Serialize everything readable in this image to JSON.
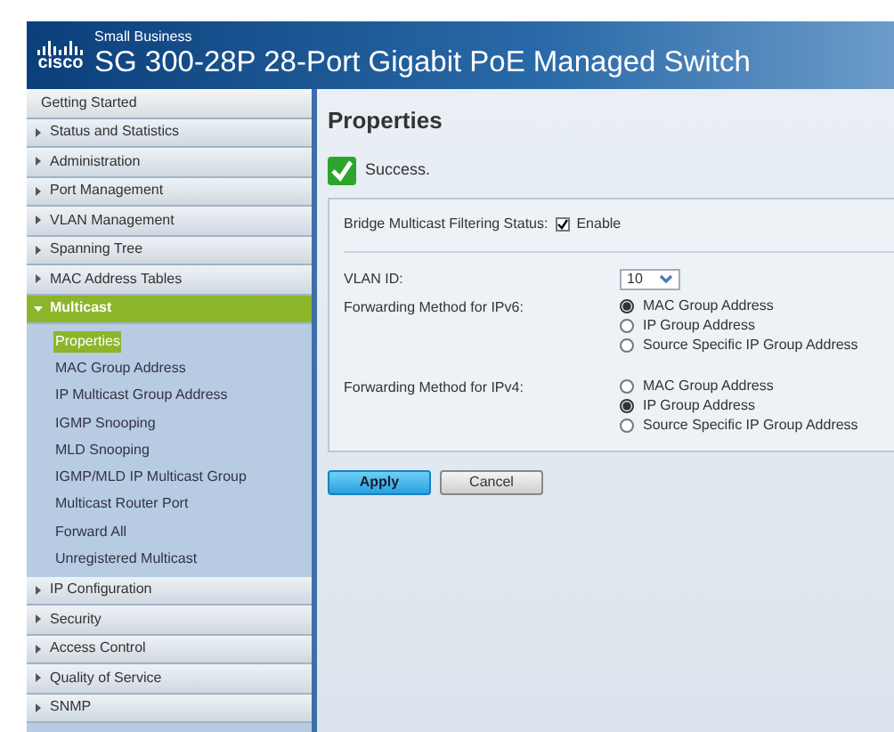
{
  "header": {
    "logo": "cisco",
    "subtitle": "Small Business",
    "title": "SG 300-28P 28-Port Gigabit PoE Managed Switch"
  },
  "sidebar": {
    "items": [
      {
        "label": "Getting Started",
        "kind": "plain"
      },
      {
        "label": "Status and Statistics",
        "kind": "section",
        "expanded": false
      },
      {
        "label": "Administration",
        "kind": "section",
        "expanded": false
      },
      {
        "label": "Port Management",
        "kind": "section",
        "expanded": false
      },
      {
        "label": "VLAN Management",
        "kind": "section",
        "expanded": false
      },
      {
        "label": "Spanning Tree",
        "kind": "section",
        "expanded": false
      },
      {
        "label": "MAC Address Tables",
        "kind": "section",
        "expanded": false
      },
      {
        "label": "Multicast",
        "kind": "section",
        "expanded": true,
        "children": [
          {
            "label": "Properties",
            "selected": true
          },
          {
            "label": "MAC Group Address",
            "selected": false
          },
          {
            "label": "IP Multicast Group Address",
            "selected": false
          },
          {
            "label": "IGMP Snooping",
            "selected": false
          },
          {
            "label": "MLD Snooping",
            "selected": false
          },
          {
            "label": "IGMP/MLD IP Multicast Group",
            "selected": false
          },
          {
            "label": "Multicast Router Port",
            "selected": false
          },
          {
            "label": "Forward All",
            "selected": false
          },
          {
            "label": "Unregistered Multicast",
            "selected": false
          }
        ]
      },
      {
        "label": "IP Configuration",
        "kind": "section",
        "expanded": false
      },
      {
        "label": "Security",
        "kind": "section",
        "expanded": false
      },
      {
        "label": "Access Control",
        "kind": "section",
        "expanded": false
      },
      {
        "label": "Quality of Service",
        "kind": "section",
        "expanded": false
      },
      {
        "label": "SNMP",
        "kind": "section",
        "expanded": false
      }
    ]
  },
  "main": {
    "title": "Properties",
    "status": {
      "message": "Success."
    },
    "bridge_filtering": {
      "label": "Bridge Multicast Filtering Status:",
      "option": "Enable",
      "checked": true
    },
    "vlan_id": {
      "label": "VLAN ID:",
      "value": "10"
    },
    "forwarding": [
      {
        "label": "Forwarding Method for IPv6:",
        "options": [
          {
            "label": "MAC Group Address",
            "selected": true
          },
          {
            "label": "IP Group Address",
            "selected": false
          },
          {
            "label": "Source Specific IP Group Address",
            "selected": false
          }
        ]
      },
      {
        "label": "Forwarding Method for IPv4:",
        "options": [
          {
            "label": "MAC Group Address",
            "selected": false
          },
          {
            "label": "IP Group Address",
            "selected": true
          },
          {
            "label": "Source Specific IP Group Address",
            "selected": false
          }
        ]
      }
    ],
    "buttons": [
      {
        "label": "Apply",
        "kind": "primary"
      },
      {
        "label": "Cancel",
        "kind": "secondary"
      }
    ]
  }
}
